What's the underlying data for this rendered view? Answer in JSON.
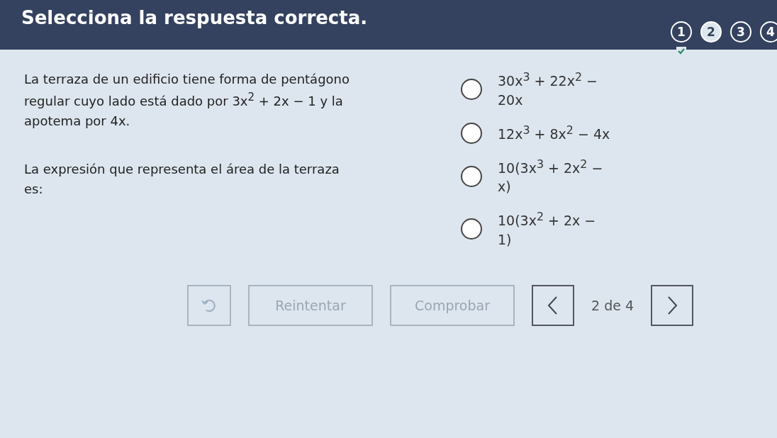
{
  "header": {
    "title": "Selecciona la respuesta correcta.",
    "steps": [
      {
        "label": "1",
        "selected": false,
        "done": true
      },
      {
        "label": "2",
        "selected": true,
        "done": false
      },
      {
        "label": "3",
        "selected": false,
        "done": false
      },
      {
        "label": "4",
        "selected": false,
        "done": false
      }
    ]
  },
  "question": {
    "paragraphs": [
      "La terraza de un edificio tiene forma de pentágono regular cuyo lado está dado por 3x$^{2}$ + 2x − 1 y la apotema por 4x.",
      "La expresión que representa el área de la terraza es:"
    ]
  },
  "options": [
    {
      "text": "30x$^{3}$ + 22x$^{2}$ − 20x",
      "selected": false
    },
    {
      "text": "12x$^{3}$ + 8x$^{2}$ − 4x",
      "selected": false
    },
    {
      "text": "10(3x$^{3}$ + 2x$^{2}$ − x)",
      "selected": false
    },
    {
      "text": "10(3x$^{2}$ + 2x − 1)",
      "selected": false
    }
  ],
  "footer": {
    "retry": {
      "label": "Reintentar",
      "disabled": true
    },
    "check": {
      "label": "Comprobar",
      "disabled": true
    },
    "page": "2 de 4"
  }
}
